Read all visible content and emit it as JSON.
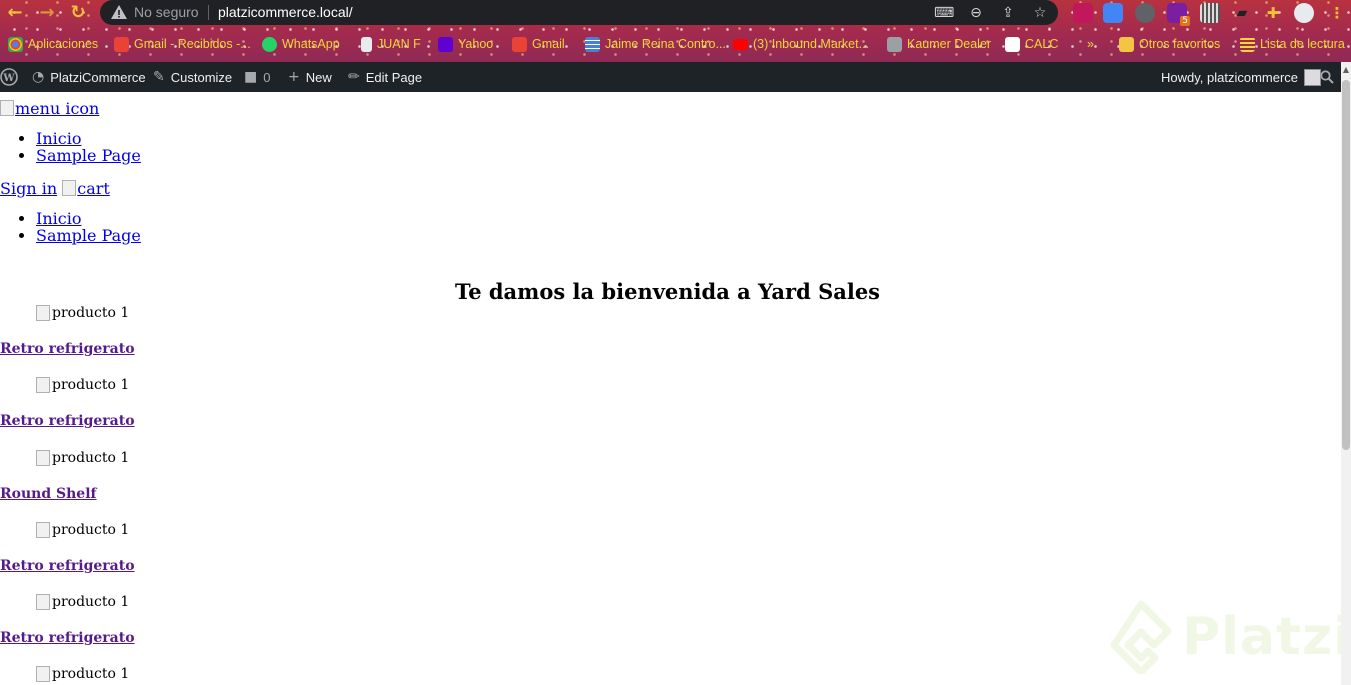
{
  "browser": {
    "security_label": "No seguro",
    "url": "platzicommerce.local/",
    "extension_badge": "5",
    "bookmarks": [
      {
        "label": "Aplicaciones",
        "icon": "apps-grid-icon",
        "color": "#f4b400"
      },
      {
        "label": "Gmail - Recibidos -...",
        "icon": "gmail-icon",
        "color": "#ea4335"
      },
      {
        "label": "WhatsApp",
        "icon": "whatsapp-icon",
        "color": "#25d366"
      },
      {
        "label": "JUAN F",
        "icon": "bookmark-page-icon",
        "color": "#e8eaed"
      },
      {
        "label": "Yahoo",
        "icon": "yahoo-icon",
        "color": "#5f01d1"
      },
      {
        "label": "Gmail",
        "icon": "gmail-icon",
        "color": "#ea4335"
      },
      {
        "label": "Jaime Reina Contro...",
        "icon": "sheet-icon",
        "color": "#4a7fd8"
      },
      {
        "label": "(3) Inbound Market...",
        "icon": "youtube-icon",
        "color": "#ff0000"
      },
      {
        "label": "Kaumer Dealer",
        "icon": "car-icon",
        "color": "#9aa0a6"
      },
      {
        "label": "CALC",
        "icon": "calc-icon",
        "color": "#ffffff"
      }
    ],
    "other_bookmarks": "Otros favoritos",
    "reading_list": "Lista de lectura"
  },
  "adminbar": {
    "site_name": "PlatziCommerce",
    "customize": "Customize",
    "comments_count": "0",
    "new": "New",
    "edit_page": "Edit Page",
    "howdy": "Howdy, platzicommerce"
  },
  "page": {
    "menu_icon_alt": "menu icon",
    "nav_primary": [
      "Inicio",
      "Sample Page"
    ],
    "sign_in": "Sign in",
    "cart_alt": "cart",
    "nav_secondary": [
      "Inicio",
      "Sample Page"
    ],
    "welcome_title": "Te damos la bienvenida a Yard Sales",
    "products": [
      {
        "img_alt": "producto 1",
        "name": "Retro refrigerato"
      },
      {
        "img_alt": "producto 1",
        "name": "Retro refrigerato"
      },
      {
        "img_alt": "producto 1",
        "name": "Round Shelf"
      },
      {
        "img_alt": "producto 1",
        "name": "Retro refrigerato"
      },
      {
        "img_alt": "producto 1",
        "name": "Retro refrigerato"
      },
      {
        "img_alt": "producto 1",
        "name": ""
      }
    ]
  },
  "watermark": "Platzi"
}
